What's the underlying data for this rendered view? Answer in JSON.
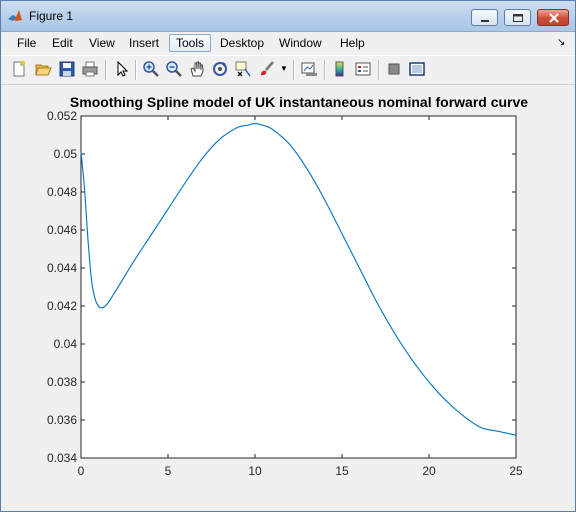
{
  "window": {
    "title": "Figure 1"
  },
  "menu": {
    "items": [
      "File",
      "Edit",
      "View",
      "Insert",
      "Tools",
      "Desktop",
      "Window",
      "Help"
    ],
    "active": "Tools"
  },
  "toolbar": {
    "icons": [
      "new-figure-icon",
      "open-icon",
      "save-icon",
      "print-icon",
      "pointer-icon",
      "zoom-in-icon",
      "zoom-out-icon",
      "pan-icon",
      "rotate-icon",
      "data-cursor-icon",
      "brush-icon",
      "link-plot-icon",
      "colorbar-icon",
      "legend-icon",
      "hide-plot-tools-icon",
      "show-plot-tools-icon"
    ]
  },
  "chart_data": {
    "type": "line",
    "title": "Smoothing Spline model of UK instantaneous nominal forward curve",
    "xlabel": "",
    "ylabel": "",
    "xlim": [
      0,
      25
    ],
    "ylim": [
      0.034,
      0.052
    ],
    "xticks": [
      "0",
      "5",
      "10",
      "15",
      "20",
      "25"
    ],
    "yticks": [
      "0.034",
      "0.036",
      "0.038",
      "0.04",
      "0.042",
      "0.044",
      "0.046",
      "0.048",
      "0.05",
      "0.052"
    ],
    "grid": false,
    "line_color": "#0072bd",
    "x": [
      0,
      0.2,
      0.4,
      0.6,
      0.8,
      1.0,
      1.2,
      1.5,
      2,
      3,
      4,
      5,
      6,
      7,
      8,
      9,
      9.5,
      10,
      10.5,
      11,
      12,
      13,
      14,
      15,
      16,
      17,
      18,
      19,
      20,
      21,
      22,
      23,
      24,
      25
    ],
    "y": [
      0.0501,
      0.0482,
      0.0455,
      0.0434,
      0.0424,
      0.042,
      0.0419,
      0.0421,
      0.0428,
      0.0443,
      0.0457,
      0.0471,
      0.0485,
      0.0498,
      0.0508,
      0.0514,
      0.0515,
      0.0516,
      0.0515,
      0.0513,
      0.0505,
      0.0492,
      0.0476,
      0.0458,
      0.044,
      0.0422,
      0.0406,
      0.0392,
      0.038,
      0.037,
      0.0362,
      0.0356,
      0.0354,
      0.0352
    ]
  }
}
